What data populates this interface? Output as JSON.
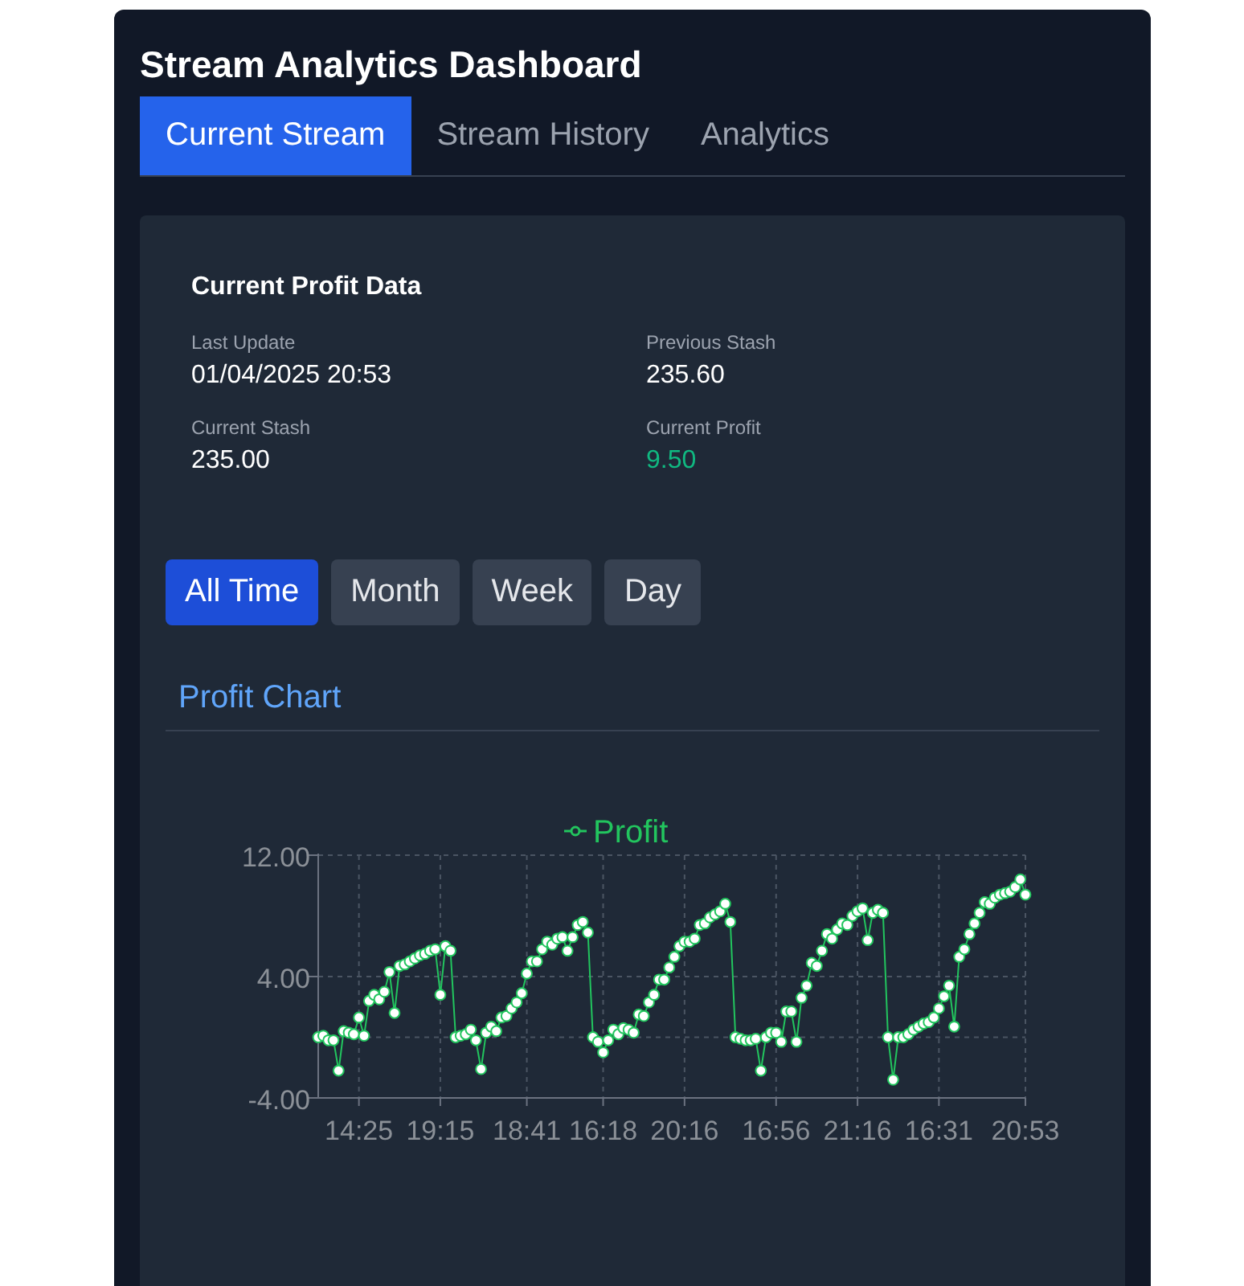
{
  "title": "Stream Analytics Dashboard",
  "tabs": [
    {
      "label": "Current Stream",
      "selected": true
    },
    {
      "label": "Stream History",
      "selected": false
    },
    {
      "label": "Analytics",
      "selected": false
    }
  ],
  "profit_data": {
    "title": "Current Profit Data",
    "fields": [
      {
        "label": "Last Update",
        "value": "01/04/2025 20:53",
        "kind": "plain"
      },
      {
        "label": "Previous Stash",
        "value": "235.60",
        "kind": "plain"
      },
      {
        "label": "Current Stash",
        "value": "235.00",
        "kind": "plain"
      },
      {
        "label": "Current Profit",
        "value": "9.50",
        "kind": "profit"
      }
    ]
  },
  "ranges": [
    {
      "label": "All Time",
      "selected": true
    },
    {
      "label": "Month",
      "selected": false
    },
    {
      "label": "Week",
      "selected": false
    },
    {
      "label": "Day",
      "selected": false
    }
  ],
  "chart_section": {
    "title": "Profit Chart",
    "chart_data": {
      "type": "line",
      "ylim": [
        -4,
        12
      ],
      "yticks": [
        {
          "value": -4,
          "label": "-4.00"
        },
        {
          "value": 4,
          "label": "4.00"
        },
        {
          "value": 12,
          "label": "12.00"
        }
      ],
      "categories": [
        null,
        null,
        null,
        null,
        null,
        null,
        null,
        null,
        "14:25",
        null,
        null,
        null,
        null,
        null,
        null,
        null,
        null,
        null,
        null,
        null,
        null,
        null,
        null,
        null,
        "19:15",
        null,
        null,
        null,
        null,
        null,
        null,
        null,
        null,
        null,
        null,
        null,
        null,
        null,
        null,
        null,
        null,
        "18:41",
        null,
        null,
        null,
        null,
        null,
        null,
        null,
        null,
        null,
        null,
        null,
        null,
        null,
        null,
        "16:18",
        null,
        null,
        null,
        null,
        null,
        null,
        null,
        null,
        null,
        null,
        null,
        null,
        null,
        null,
        null,
        "20:16",
        null,
        null,
        null,
        null,
        null,
        null,
        null,
        null,
        null,
        null,
        null,
        null,
        null,
        null,
        null,
        null,
        null,
        "16:56",
        null,
        null,
        null,
        null,
        null,
        null,
        null,
        null,
        null,
        null,
        null,
        null,
        null,
        null,
        null,
        "21:16",
        null,
        null,
        null,
        null,
        null,
        null,
        null,
        null,
        null,
        null,
        null,
        null,
        null,
        null,
        null,
        "16:31",
        null,
        null,
        null,
        null,
        null,
        null,
        null,
        null,
        null,
        null,
        null,
        null,
        null,
        null,
        null,
        null,
        "20:53"
      ],
      "series": [
        {
          "name": "Profit",
          "color": "#22c55e",
          "marker": "circle",
          "values": [
            0,
            0.1,
            -0.2,
            -0.2,
            -2.2,
            0.4,
            0.3,
            0.2,
            1.3,
            0.1,
            2.4,
            2.8,
            2.5,
            3,
            4.3,
            1.6,
            4.7,
            4.8,
            5,
            5.2,
            5.4,
            5.5,
            5.7,
            5.8,
            2.8,
            6,
            5.7,
            0,
            0.1,
            0.2,
            0.5,
            -0.2,
            -2.1,
            0.3,
            0.7,
            0.4,
            1.3,
            1.4,
            1.9,
            2.3,
            2.9,
            4.2,
            5,
            5,
            5.8,
            6.3,
            6.1,
            6.5,
            6.6,
            5.7,
            6.6,
            7.4,
            7.6,
            6.9,
            0,
            -0.3,
            -1,
            -0.2,
            0.5,
            0.2,
            0.6,
            0.5,
            0.3,
            1.5,
            1.4,
            2.3,
            2.8,
            3.8,
            3.8,
            4.6,
            5.3,
            6,
            6.3,
            6.3,
            6.5,
            7.4,
            7.5,
            7.9,
            8.1,
            8.3,
            8.8,
            7.6,
            0,
            -0.1,
            -0.2,
            -0.2,
            -0.1,
            -2.2,
            0,
            0.3,
            0.3,
            -0.3,
            1.7,
            1.7,
            -0.3,
            2.6,
            3.4,
            4.9,
            4.7,
            5.7,
            6.8,
            6.5,
            7.1,
            7.5,
            7.4,
            8,
            8.3,
            8.5,
            6.4,
            8.2,
            8.4,
            8.2,
            0,
            -2.8,
            0,
            0,
            0.2,
            0.5,
            0.7,
            0.9,
            1,
            1.3,
            1.9,
            2.7,
            3.4,
            0.7,
            5.3,
            5.8,
            6.8,
            7.5,
            8.2,
            8.9,
            8.8,
            9.2,
            9.4,
            9.5,
            9.6,
            9.9,
            10.4,
            9.4
          ]
        }
      ]
    }
  }
}
